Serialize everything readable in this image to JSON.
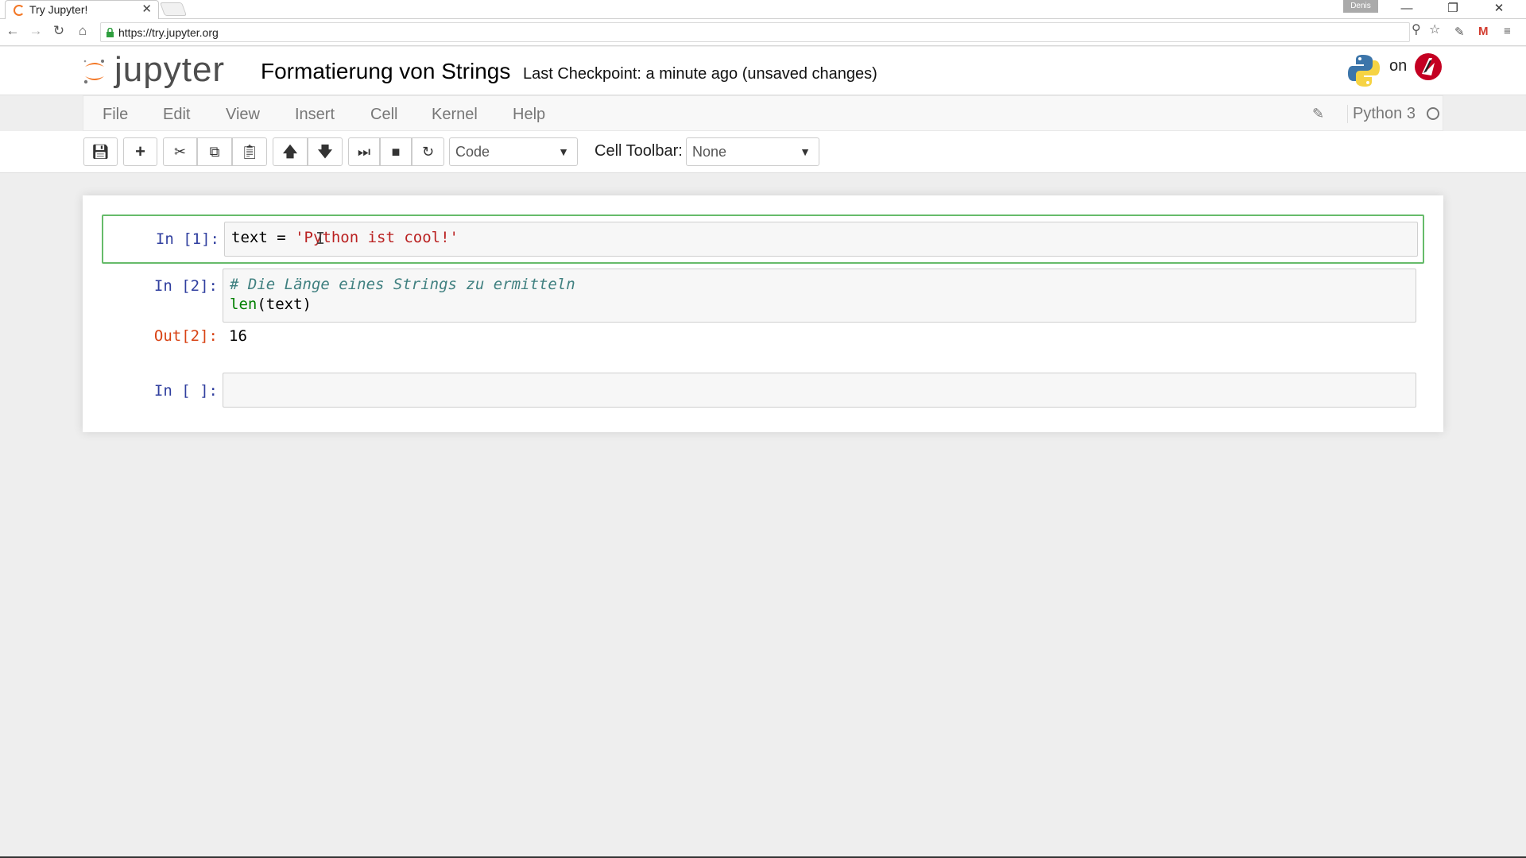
{
  "browser": {
    "tab_title": "Try Jupyter!",
    "tab_close": "✕",
    "profile_name": "Denis",
    "url": "https://try.jupyter.org",
    "window_controls": {
      "minimize": "—",
      "restore": "❐",
      "close": "✕"
    },
    "nav": {
      "back": "←",
      "forward": "→",
      "reload": "↻",
      "home": "⌂"
    },
    "icons": [
      "zoom-icon",
      "star-icon",
      "extension-icon",
      "gmail-icon",
      "menu-icon"
    ]
  },
  "header": {
    "logo_text": "jupyter",
    "notebook_title": "Formatierung von Strings",
    "checkpoint": "Last Checkpoint: a minute ago (unsaved changes)",
    "on_label": "on"
  },
  "menubar": {
    "items": [
      "File",
      "Edit",
      "View",
      "Insert",
      "Cell",
      "Kernel",
      "Help"
    ],
    "kernel_name": "Python 3"
  },
  "toolbar": {
    "cell_type": "Code",
    "cell_toolbar_label": "Cell Toolbar:",
    "cell_toolbar_value": "None",
    "buttons": [
      "save-icon",
      "plus-icon",
      "cut-icon",
      "copy-icon",
      "paste-icon",
      "arrow-up-icon",
      "arrow-down-icon",
      "step-forward-icon",
      "stop-icon",
      "restart-icon"
    ]
  },
  "cells": [
    {
      "prompt": "In [1]:",
      "code_plain": "text = ",
      "code_string": "'Python ist cool!'",
      "selected": true
    },
    {
      "prompt": "In [2]:",
      "code_comment": "# Die Länge eines Strings zu ermitteln",
      "code_func": "len",
      "code_args": "(text)",
      "out_prompt": "Out[2]:",
      "output": "16"
    },
    {
      "prompt": "In [ ]:",
      "code": ""
    }
  ],
  "colors": {
    "jupyter_orange": "#f37726",
    "selected_border": "#66bb6a",
    "in_prompt": "#303f9f",
    "out_prompt": "#d84315",
    "string": "#ba2121"
  }
}
